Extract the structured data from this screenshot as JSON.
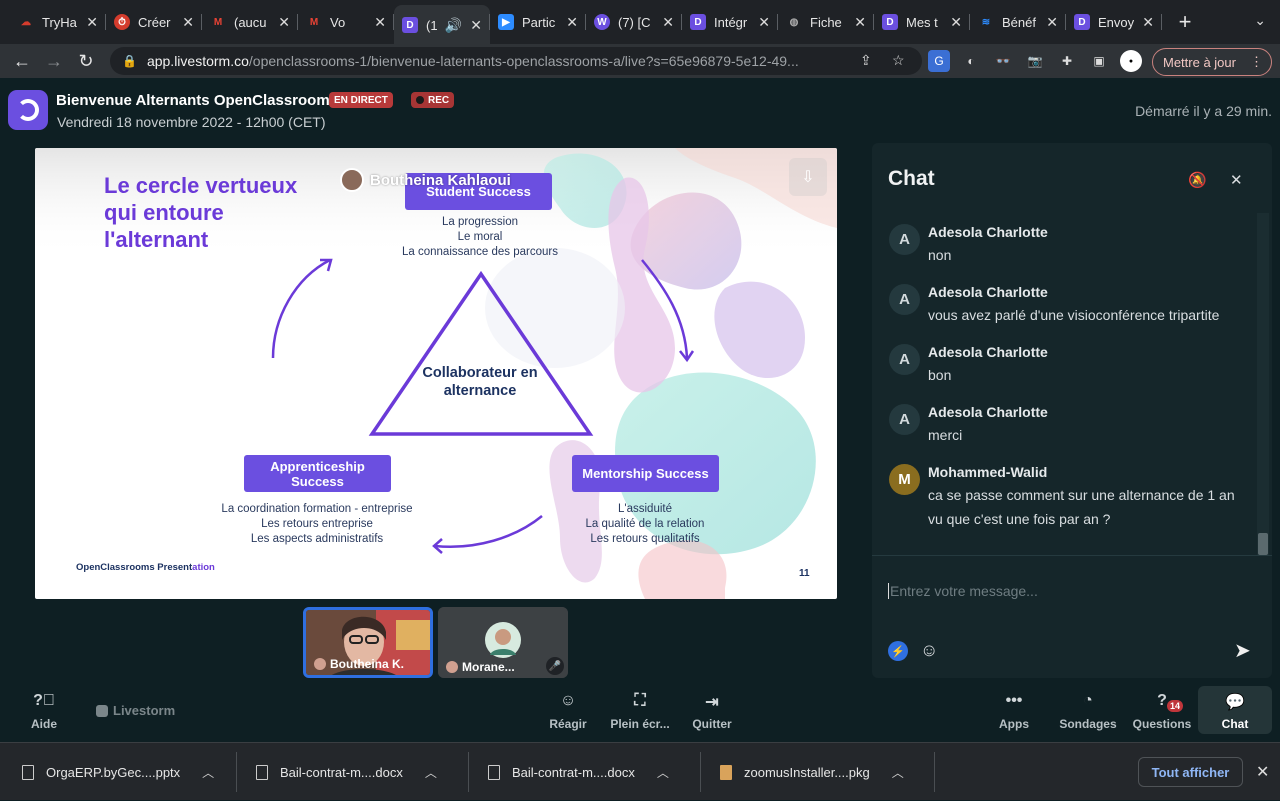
{
  "browser": {
    "tabs": [
      {
        "label": "TryHa",
        "icon": "cloud-icon",
        "color": "#d43c2d"
      },
      {
        "label": "Créer",
        "icon": "stopwatch-icon",
        "color": "#d43c2d"
      },
      {
        "label": "(aucu",
        "icon": "gmail-icon",
        "color": "#ea4335"
      },
      {
        "label": "Vo",
        "icon": "gmail-icon",
        "color": "#ea4335"
      },
      {
        "label": "(1",
        "icon": "livestorm-icon",
        "color": "#6b4fe0",
        "active": true
      },
      {
        "label": "Partic",
        "icon": "zoom-icon",
        "color": "#2d8cff"
      },
      {
        "label": "(7) [C",
        "icon": "app-icon",
        "color": "#6b4fe0"
      },
      {
        "label": "Intégr",
        "icon": "livestorm-icon",
        "color": "#6b4fe0"
      },
      {
        "label": "Fiche",
        "icon": "globe-icon",
        "color": "#8a8d90"
      },
      {
        "label": "Mes t",
        "icon": "livestorm-icon",
        "color": "#6b4fe0"
      },
      {
        "label": "Bénéf",
        "icon": "app-icon",
        "color": "#2d8cff"
      },
      {
        "label": "Envoy",
        "icon": "livestorm-icon",
        "color": "#6b4fe0"
      }
    ],
    "url_host": "app.livestorm.co",
    "url_path": "/openclassrooms-1/bienvenue-laternants-openclassrooms-a/live?s=65e96879-5e12-49...",
    "update_label": "Mettre à jour"
  },
  "event": {
    "title": "Bienvenue Alternants OpenClassrooms",
    "live_badge": "EN DIRECT",
    "rec_badge": "REC",
    "date": "Vendredi 18 novembre 2022 - 12h00 (CET)",
    "started": "Démarré il y a 29 min."
  },
  "slide": {
    "title": "Le cercle vertueux qui entoure l'alternant",
    "speaker": "Boutheina Kahlaoui",
    "top_box": "Student Success",
    "top_items": [
      "La progression",
      "Le moral",
      "La connaissance des parcours"
    ],
    "center": "Collaborateur en alternance",
    "left_box": "Apprenticeship Success",
    "left_items": [
      "La coordination formation - entreprise",
      "Les retours entreprise",
      "Les aspects administratifs"
    ],
    "right_box": "Mentorship Success",
    "right_items": [
      "L'assiduité",
      "La qualité de la relation",
      "Les retours qualitatifs"
    ],
    "footer_prefix": "OpenClassrooms Present",
    "footer_suffix": "ation",
    "page": "11"
  },
  "videos": [
    {
      "name": "Boutheina K."
    },
    {
      "name": "Morane..."
    }
  ],
  "chat": {
    "title": "Chat",
    "messages": [
      {
        "initial": "A",
        "author": "Adesola Charlotte",
        "text": "non"
      },
      {
        "initial": "A",
        "author": "Adesola Charlotte",
        "text": "vous avez parlé d'une visioconférence tripartite"
      },
      {
        "initial": "A",
        "author": "Adesola Charlotte",
        "text": "bon"
      },
      {
        "initial": "A",
        "author": "Adesola Charlotte",
        "text": "merci"
      },
      {
        "initial": "M",
        "author": "Mohammed-Walid",
        "text": "ca se passe comment sur une alternance de 1 an vu que c'est une fois par an ?"
      }
    ],
    "placeholder": "Entrez votre message..."
  },
  "bottombar": {
    "help": "Aide",
    "brand": "Livestorm",
    "react": "Réagir",
    "fullscreen": "Plein écr...",
    "quit": "Quitter",
    "apps": "Apps",
    "polls": "Sondages",
    "questions": "Questions",
    "questions_count": "14",
    "chat": "Chat"
  },
  "downloads": {
    "items": [
      "OrgaERP.byGec....pptx",
      "Bail-contrat-m....docx",
      "Bail-contrat-m....docx",
      "zoomusInstaller....pkg"
    ],
    "show_all": "Tout afficher"
  }
}
